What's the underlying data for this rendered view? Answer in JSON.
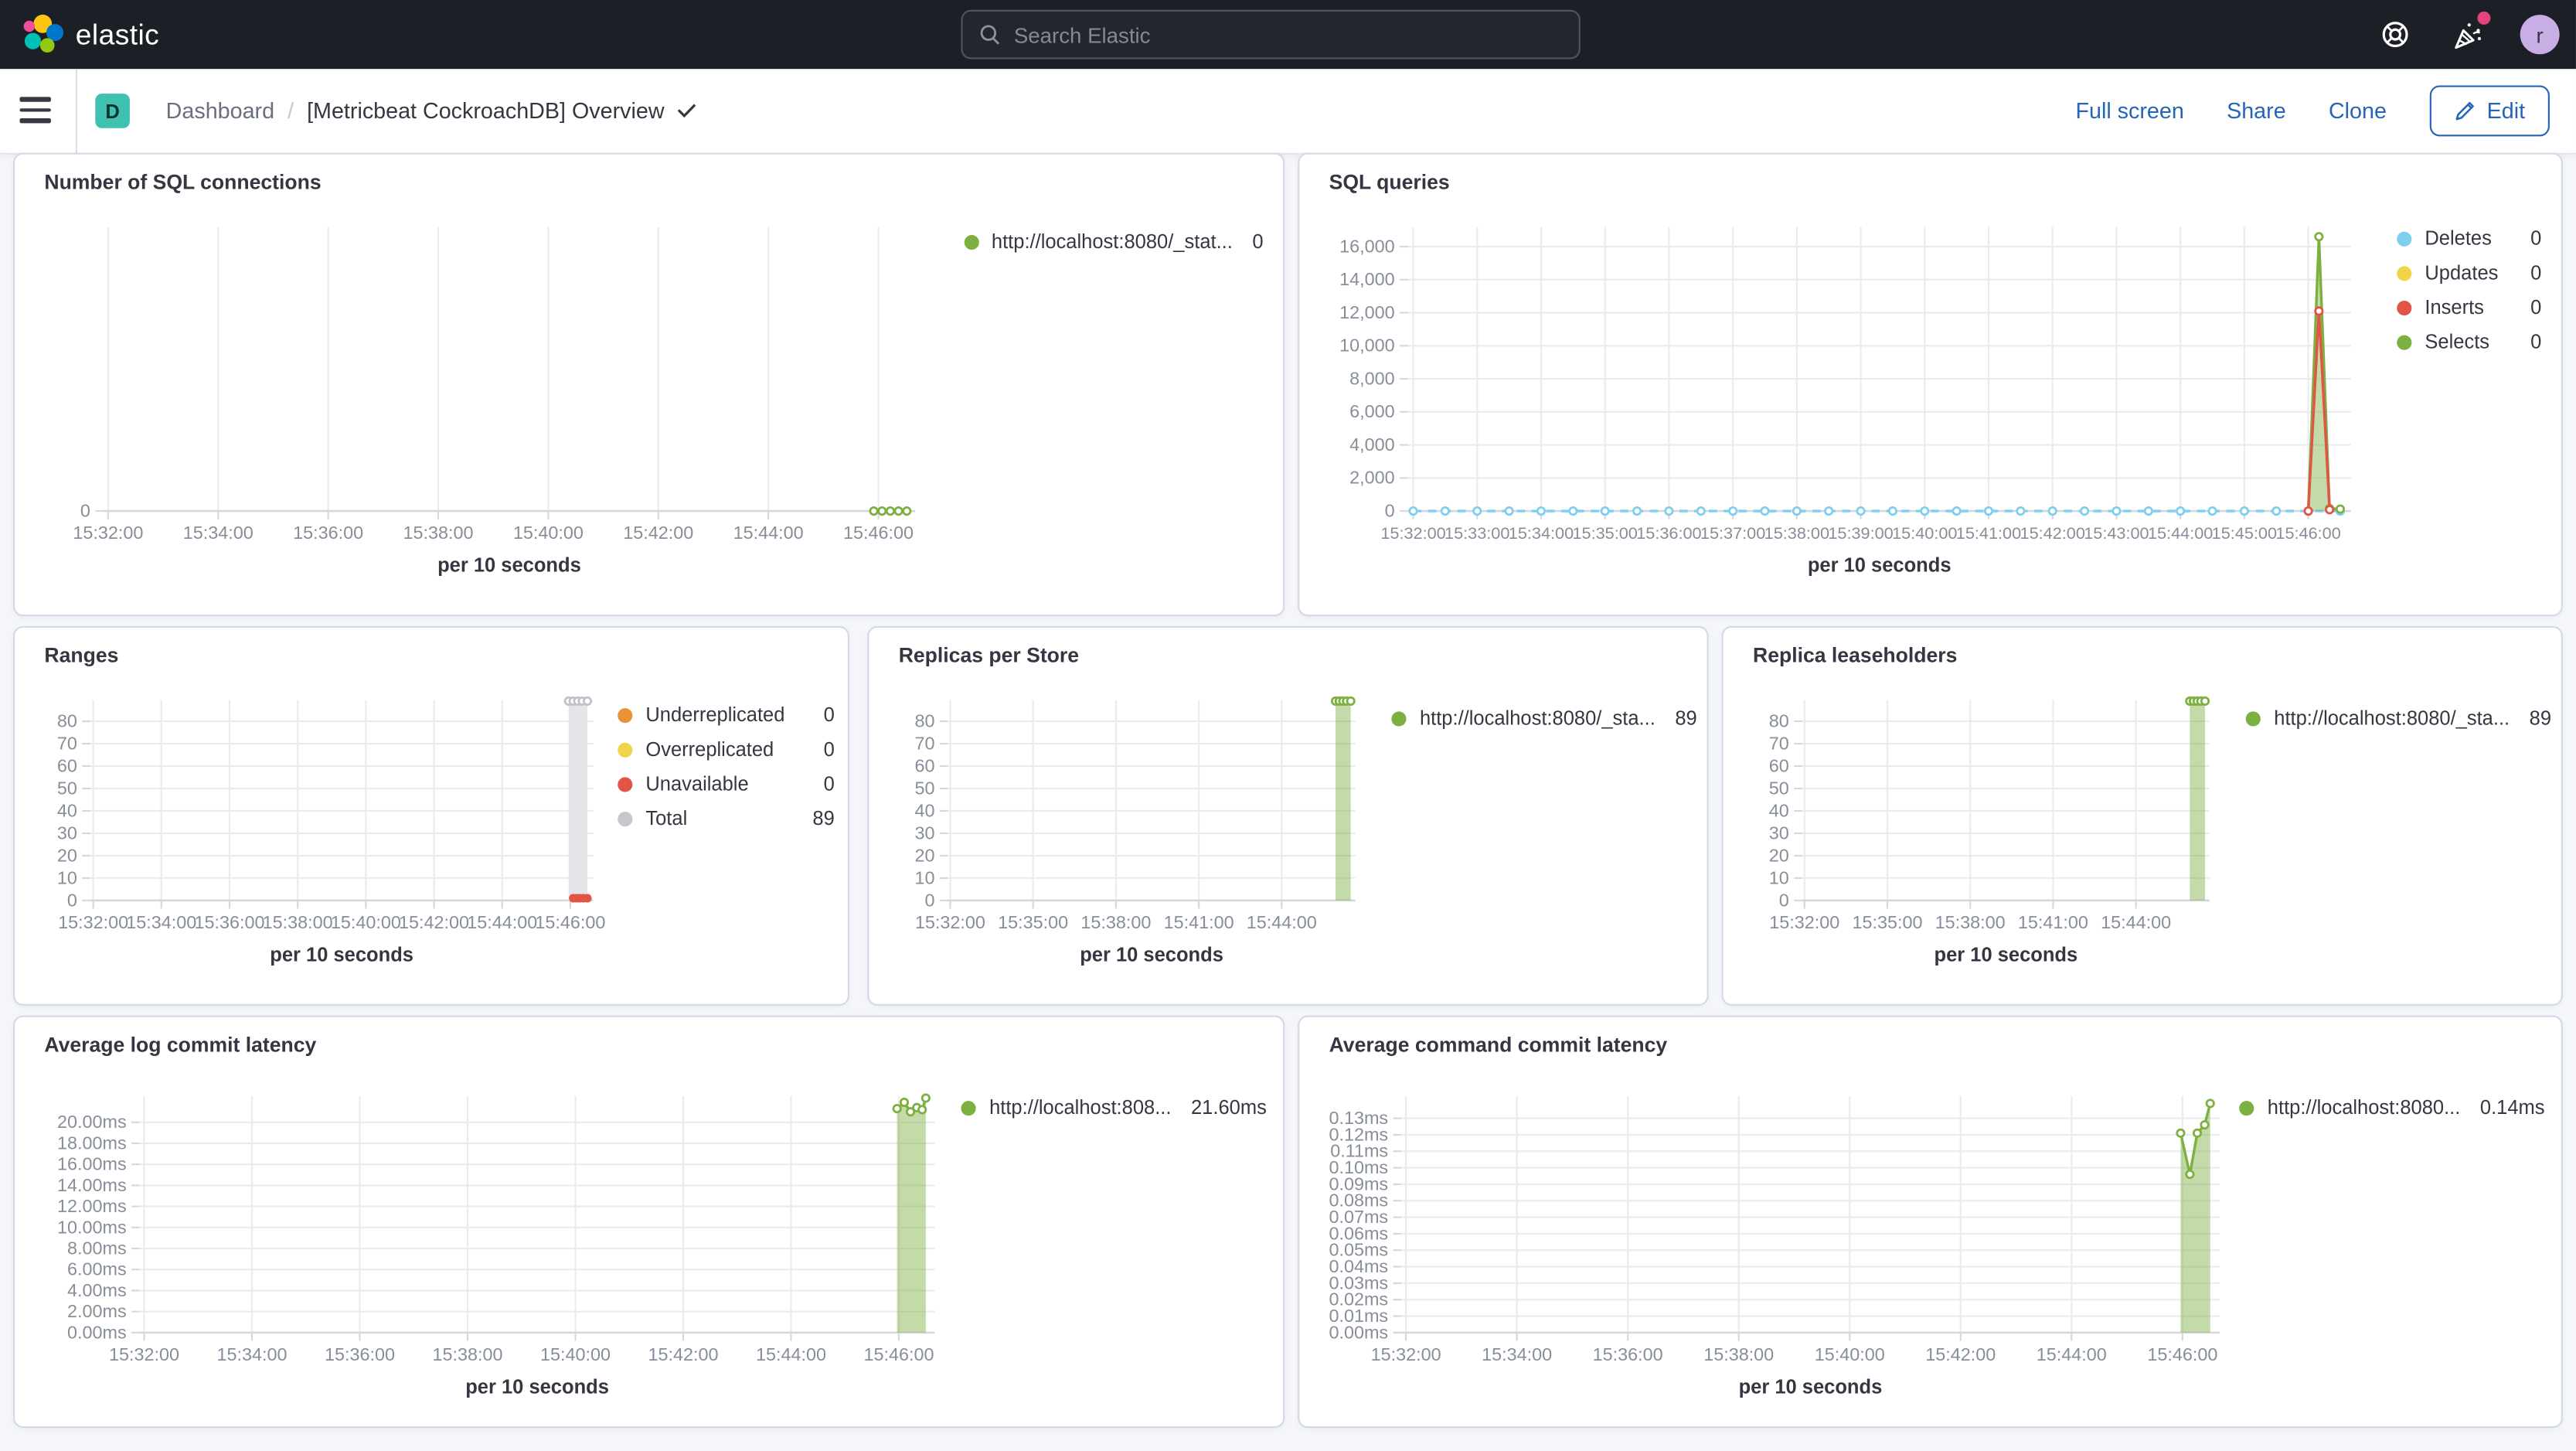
{
  "header": {
    "logo_text": "elastic",
    "search_placeholder": "Search Elastic",
    "avatar_letter": "r",
    "avatar_color": "#C9AEE5",
    "news_badge_color": "#E3447E"
  },
  "toolbar": {
    "app_badge": "D",
    "app_badge_color": "#3FC1B2",
    "breadcrumb_root": "Dashboard",
    "breadcrumb_separator": "/",
    "title": "[Metricbeat CockroachDB] Overview",
    "actions": {
      "full_screen": "Full screen",
      "share": "Share",
      "clone": "Clone",
      "edit": "Edit"
    }
  },
  "colors": {
    "link_blue": "#2565B7",
    "header_bg": "#1D1F26",
    "page_bg": "#F4F6FA",
    "panel_border": "#D3DAE6",
    "grid": "#E9EBEF",
    "axis": "#D4D7DC",
    "tick_text": "#878E99",
    "title_text": "#343741",
    "series_green": "#7CB040",
    "series_blue": "#7DCFF0",
    "series_yellow": "#F0D54A",
    "series_red": "#E15546",
    "series_orange": "#EB9236",
    "series_grey": "#C5C7CD"
  },
  "chart_data": [
    {
      "panel_title": "Number of SQL connections",
      "type": "line",
      "x_axis_title": "per 10 seconds",
      "x_domain": [
        "15:31:55",
        "15:46:40"
      ],
      "x_ticks": [
        "15:32:00",
        "15:34:00",
        "15:36:00",
        "15:38:00",
        "15:40:00",
        "15:42:00",
        "15:44:00",
        "15:46:00"
      ],
      "ylim": [
        0,
        1
      ],
      "y_ticks": {
        "values": [
          0
        ],
        "labels": [
          "0"
        ]
      },
      "legend": [
        {
          "label": "http://localhost:8080/_stat...",
          "value": "0",
          "color": "#7CB040"
        }
      ],
      "series": [
        {
          "name": "connections",
          "color": "#7CB040",
          "line": "dashed",
          "markers": "open",
          "repeat": {
            "from": "15:45:55",
            "to": "15:46:31",
            "step_s": 9,
            "v": 0
          }
        }
      ]
    },
    {
      "panel_title": "SQL queries",
      "type": "area",
      "x_axis_title": "per 10 seconds",
      "x_domain": [
        "15:31:55",
        "15:46:40"
      ],
      "x_ticks": [
        "15:32:00",
        "15:33:00",
        "15:34:00",
        "15:35:00",
        "15:36:00",
        "15:37:00",
        "15:38:00",
        "15:39:00",
        "15:40:00",
        "15:41:00",
        "15:42:00",
        "15:43:00",
        "15:44:00",
        "15:45:00",
        "15:46:00"
      ],
      "ylim": [
        0,
        17200
      ],
      "y_ticks": {
        "values": [
          0,
          2000,
          4000,
          6000,
          8000,
          10000,
          12000,
          14000,
          16000
        ],
        "labels": [
          "0",
          "2,000",
          "4,000",
          "6,000",
          "8,000",
          "10,000",
          "12,000",
          "14,000",
          "16,000"
        ]
      },
      "legend": [
        {
          "label": "Deletes",
          "value": "0",
          "color": "#7DCFF0"
        },
        {
          "label": "Updates",
          "value": "0",
          "color": "#F0D54A"
        },
        {
          "label": "Inserts",
          "value": "0",
          "color": "#E15546"
        },
        {
          "label": "Selects",
          "value": "0",
          "color": "#7CB040"
        }
      ],
      "series": [
        {
          "name": "Deletes",
          "color": "#7DCFF0",
          "line": "dashed",
          "markers": "open",
          "repeat": {
            "from": "15:32:00",
            "to": "15:46:30",
            "step_s": 30,
            "v": 0
          }
        },
        {
          "name": "Selects",
          "color": "#7CB040",
          "fill": "rgba(124,176,64,0.45)",
          "line": "solid",
          "markers": "open",
          "points": [
            [
              "15:46:00",
              0
            ],
            [
              "15:46:10",
              16600
            ],
            [
              "15:46:20",
              150
            ],
            [
              "15:46:30",
              120
            ]
          ]
        },
        {
          "name": "Inserts",
          "color": "#E15546",
          "line": "solid",
          "markers": "open",
          "points": [
            [
              "15:46:00",
              0
            ],
            [
              "15:46:10",
              12100
            ],
            [
              "15:46:20",
              80
            ]
          ]
        }
      ]
    },
    {
      "panel_title": "Ranges",
      "type": "area",
      "x_axis_title": "per 10 seconds",
      "x_domain": [
        "15:31:55",
        "15:46:40"
      ],
      "x_ticks": [
        "15:32:00",
        "15:34:00",
        "15:36:00",
        "15:38:00",
        "15:40:00",
        "15:42:00",
        "15:44:00",
        "15:46:00"
      ],
      "ylim": [
        0,
        89.5
      ],
      "y_ticks": {
        "values": [
          0,
          10,
          20,
          30,
          40,
          50,
          60,
          70,
          80
        ],
        "labels": [
          "0",
          "10",
          "20",
          "30",
          "40",
          "50",
          "60",
          "70",
          "80"
        ]
      },
      "legend": [
        {
          "label": "Underreplicated",
          "value": "0",
          "color": "#EB9236"
        },
        {
          "label": "Overreplicated",
          "value": "0",
          "color": "#F0D54A"
        },
        {
          "label": "Unavailable",
          "value": "0",
          "color": "#E15546"
        },
        {
          "label": "Total",
          "value": "89",
          "color": "#C5C7CD"
        }
      ],
      "series": [
        {
          "name": "Total",
          "color": "#BFC2C8",
          "fill": "#E4E5E8",
          "line": "none",
          "markers": "open",
          "points": [
            [
              "15:45:57",
              89
            ],
            [
              "15:46:05",
              89
            ],
            [
              "15:46:13",
              89
            ],
            [
              "15:46:21",
              89
            ],
            [
              "15:46:30",
              89
            ]
          ]
        },
        {
          "name": "Unavailable",
          "color": "#E15546",
          "line": "solid",
          "markers": "filled",
          "points": [
            [
              "15:46:05",
              1
            ],
            [
              "15:46:11",
              1
            ],
            [
              "15:46:17",
              1
            ],
            [
              "15:46:23",
              1
            ],
            [
              "15:46:30",
              1
            ]
          ]
        }
      ]
    },
    {
      "panel_title": "Replicas per Store",
      "type": "area",
      "x_axis_title": "per 10 seconds",
      "x_domain": [
        "15:31:55",
        "15:46:40"
      ],
      "x_ticks": [
        "15:32:00",
        "15:35:00",
        "15:38:00",
        "15:41:00",
        "15:44:00"
      ],
      "ylim": [
        0,
        89.5
      ],
      "y_ticks": {
        "values": [
          0,
          10,
          20,
          30,
          40,
          50,
          60,
          70,
          80
        ],
        "labels": [
          "0",
          "10",
          "20",
          "30",
          "40",
          "50",
          "60",
          "70",
          "80"
        ]
      },
      "legend": [
        {
          "label": "http://localhost:8080/_sta...",
          "value": "89",
          "color": "#7CB040"
        }
      ],
      "series": [
        {
          "name": "replicas",
          "color": "#7CB040",
          "fill": "rgba(124,176,64,0.45)",
          "line": "solid",
          "markers": "open",
          "points": [
            [
              "15:45:57",
              89
            ],
            [
              "15:46:05",
              89
            ],
            [
              "15:46:13",
              89
            ],
            [
              "15:46:21",
              89
            ],
            [
              "15:46:30",
              89
            ]
          ]
        }
      ]
    },
    {
      "panel_title": "Replica leaseholders",
      "type": "area",
      "x_axis_title": "per 10 seconds",
      "x_domain": [
        "15:31:55",
        "15:46:40"
      ],
      "x_ticks": [
        "15:32:00",
        "15:35:00",
        "15:38:00",
        "15:41:00",
        "15:44:00"
      ],
      "ylim": [
        0,
        89.5
      ],
      "y_ticks": {
        "values": [
          0,
          10,
          20,
          30,
          40,
          50,
          60,
          70,
          80
        ],
        "labels": [
          "0",
          "10",
          "20",
          "30",
          "40",
          "50",
          "60",
          "70",
          "80"
        ]
      },
      "legend": [
        {
          "label": "http://localhost:8080/_sta...",
          "value": "89",
          "color": "#7CB040"
        }
      ],
      "series": [
        {
          "name": "leaseholders",
          "color": "#7CB040",
          "fill": "rgba(124,176,64,0.45)",
          "line": "solid",
          "markers": "open",
          "points": [
            [
              "15:45:57",
              89
            ],
            [
              "15:46:05",
              89
            ],
            [
              "15:46:13",
              89
            ],
            [
              "15:46:21",
              89
            ],
            [
              "15:46:30",
              89
            ]
          ]
        }
      ]
    },
    {
      "panel_title": "Average log commit latency",
      "type": "area",
      "x_axis_title": "per 10 seconds",
      "x_domain": [
        "15:31:55",
        "15:46:40"
      ],
      "x_ticks": [
        "15:32:00",
        "15:34:00",
        "15:36:00",
        "15:38:00",
        "15:40:00",
        "15:42:00",
        "15:44:00",
        "15:46:00"
      ],
      "ylim": [
        0,
        22.5
      ],
      "y_ticks": {
        "values": [
          0,
          2,
          4,
          6,
          8,
          10,
          12,
          14,
          16,
          18,
          20
        ],
        "labels": [
          "0.00ms",
          "2.00ms",
          "4.00ms",
          "6.00ms",
          "8.00ms",
          "10.00ms",
          "12.00ms",
          "14.00ms",
          "16.00ms",
          "18.00ms",
          "20.00ms"
        ]
      },
      "legend": [
        {
          "label": "http://localhost:808...",
          "value": "21.60ms",
          "color": "#7CB040"
        }
      ],
      "series": [
        {
          "name": "log commit latency",
          "color": "#7CB040",
          "fill": "rgba(124,176,64,0.45)",
          "line": "solid",
          "markers": "open",
          "points": [
            [
              "15:45:58",
              21.3
            ],
            [
              "15:46:06",
              21.9
            ],
            [
              "15:46:13",
              21.0
            ],
            [
              "15:46:20",
              21.4
            ],
            [
              "15:46:26",
              21.2
            ],
            [
              "15:46:30",
              22.3
            ]
          ]
        }
      ]
    },
    {
      "panel_title": "Average command commit latency",
      "type": "area",
      "x_axis_title": "per 10 seconds",
      "x_domain": [
        "15:31:55",
        "15:46:40"
      ],
      "x_ticks": [
        "15:32:00",
        "15:34:00",
        "15:36:00",
        "15:38:00",
        "15:40:00",
        "15:42:00",
        "15:44:00",
        "15:46:00"
      ],
      "ylim": [
        0,
        0.1435
      ],
      "y_ticks": {
        "values": [
          0,
          0.01,
          0.02,
          0.03,
          0.04,
          0.05,
          0.06,
          0.07,
          0.08,
          0.09,
          0.1,
          0.11,
          0.12,
          0.13
        ],
        "labels": [
          "0.00ms",
          "0.01ms",
          "0.02ms",
          "0.03ms",
          "0.04ms",
          "0.05ms",
          "0.06ms",
          "0.07ms",
          "0.08ms",
          "0.09ms",
          "0.10ms",
          "0.11ms",
          "0.12ms",
          "0.13ms"
        ]
      },
      "legend": [
        {
          "label": "http://localhost:8080...",
          "value": "0.14ms",
          "color": "#7CB040"
        }
      ],
      "series": [
        {
          "name": "command commit latency",
          "color": "#7CB040",
          "fill": "rgba(124,176,64,0.45)",
          "line": "solid",
          "markers": "open",
          "points": [
            [
              "15:45:58",
              0.121
            ],
            [
              "15:46:08",
              0.096
            ],
            [
              "15:46:16",
              0.121
            ],
            [
              "15:46:24",
              0.126
            ],
            [
              "15:46:30",
              0.139
            ]
          ]
        }
      ]
    }
  ]
}
